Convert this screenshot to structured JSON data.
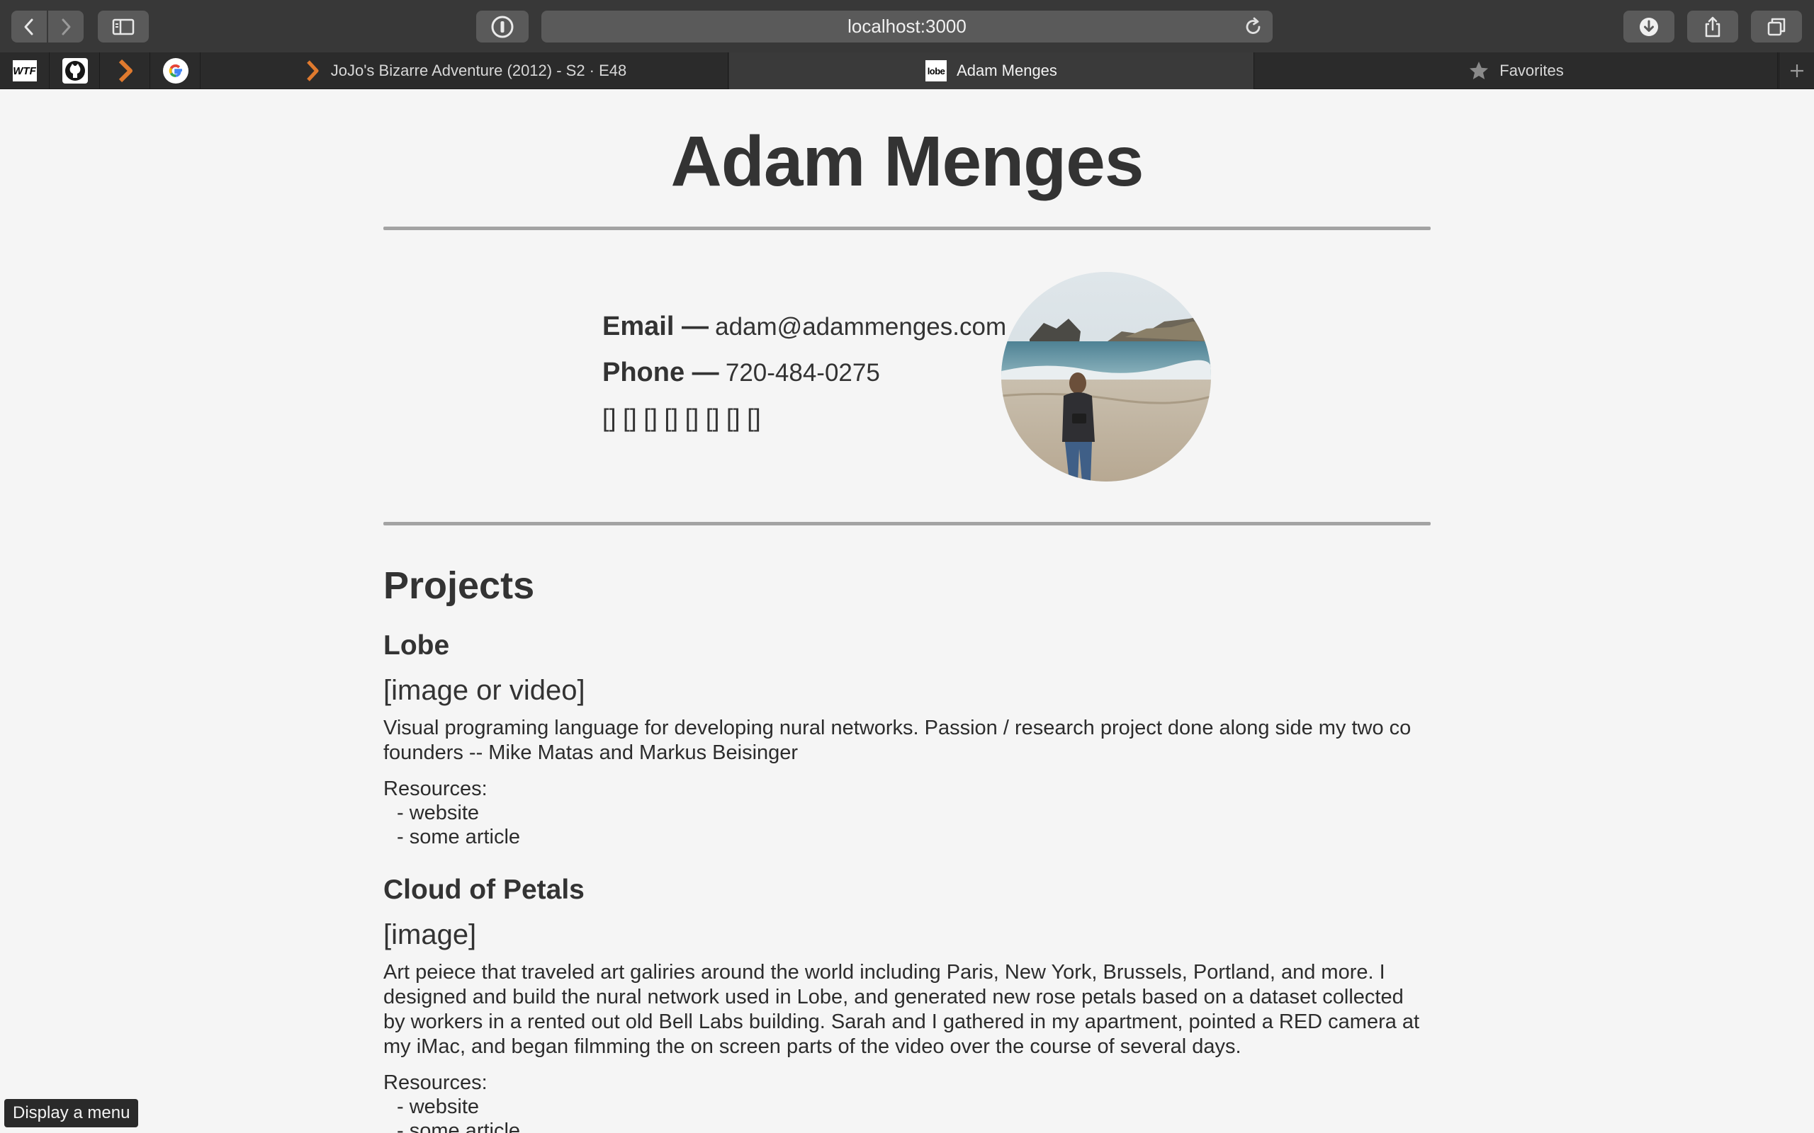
{
  "browser": {
    "url": "localhost:3000",
    "tabs": [
      {
        "title": "JoJo's Bizarre Adventure (2012) - S2 · E48",
        "icon": "crunchyroll-chevron-icon"
      },
      {
        "title": "Adam Menges",
        "icon": "lobe-favicon",
        "favicon_text": "lobe",
        "active": true
      },
      {
        "title": "Favorites",
        "icon": "star-icon"
      }
    ],
    "pinned": [
      {
        "name": "wtf-pinned-tab",
        "text": "WTF"
      },
      {
        "name": "github-pinned-tab"
      },
      {
        "name": "crunchyroll-pinned-tab"
      },
      {
        "name": "google-pinned-tab"
      }
    ],
    "colors": {
      "toolbar": "#383838",
      "tabbar": "#2b2b2b",
      "accent_orange": "#e07a2e"
    }
  },
  "page": {
    "name": "Adam Menges",
    "contact": {
      "email_label": "Email —",
      "email_value": "adam@adammenges.com",
      "phone_label": "Phone —",
      "phone_value": "720-484-0275",
      "social_placeholders": "[] [] [] [] [] [] [] []"
    },
    "projects_heading": "Projects",
    "projects": [
      {
        "title": "Lobe",
        "media": "[image or video]",
        "description": "Visual programing language for developing nural networks. Passion / research project done along side my two co founders -- Mike Matas and Markus Beisinger",
        "resources_label": "Resources:",
        "resources": [
          "- website",
          "- some article"
        ]
      },
      {
        "title": "Cloud of Petals",
        "media": "[image]",
        "description": "Art peiece that traveled art galiries around the world including Paris, New York, Brussels, Portland, and more. I designed and build the nural network used in Lobe, and generated new rose petals based on a dataset collected by workers in a rented out old Bell Labs building. Sarah and I gathered in my apartment, pointed a RED camera at my iMac, and began filmming the on screen parts of the video over the course of several days.",
        "resources_label": "Resources:",
        "resources": [
          "- website",
          "- some article"
        ]
      }
    ]
  },
  "tooltip": "Display a menu"
}
